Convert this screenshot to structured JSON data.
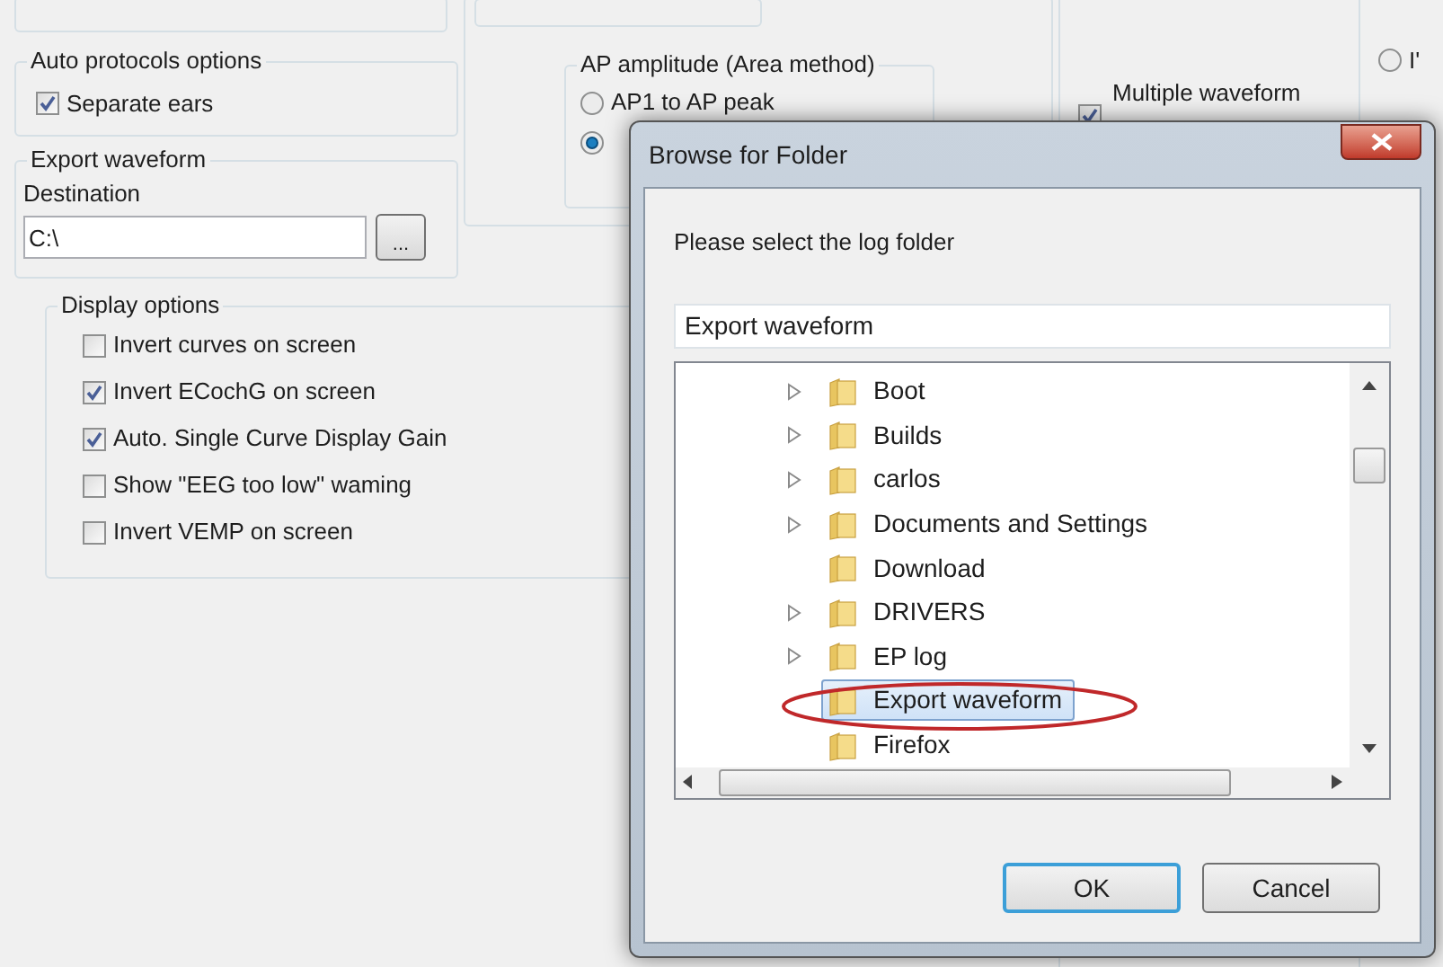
{
  "settings": {
    "auto_protocols": {
      "title": "Auto protocols options",
      "separate_ears": {
        "label": "Separate ears",
        "checked": true
      }
    },
    "export_waveform": {
      "title": "Export waveform",
      "destination_label": "Destination",
      "destination": "C:\\",
      "browse_button": "..."
    },
    "display_options": {
      "title": "Display options",
      "items": [
        {
          "label": "Invert curves on screen",
          "checked": false
        },
        {
          "label": "Invert ECochG on screen",
          "checked": true
        },
        {
          "label": "Auto. Single Curve Display Gain",
          "checked": true
        },
        {
          "label": "Show \"EEG too low\" waming",
          "checked": false
        },
        {
          "label": "Invert VEMP on screen",
          "checked": false
        }
      ]
    },
    "ap_amplitude": {
      "title": "AP amplitude (Area method)",
      "options": [
        {
          "label": "AP1 to AP peak",
          "selected": false
        },
        {
          "selected": true
        }
      ]
    },
    "multiple_waveform": {
      "label": "Multiple waveform",
      "checked": true
    },
    "column_3": {
      "options": [
        {
          "label": "I'",
          "selected": false
        }
      ]
    }
  },
  "dialog": {
    "title": "Browse for Folder",
    "prompt": "Please select the log folder",
    "folder_name": "Export waveform",
    "tree": [
      {
        "label": "Boot",
        "has_children": true,
        "selected": false
      },
      {
        "label": "Builds",
        "has_children": true,
        "selected": false
      },
      {
        "label": "carlos",
        "has_children": true,
        "selected": false
      },
      {
        "label": "Documents and Settings",
        "has_children": true,
        "selected": false
      },
      {
        "label": "Download",
        "has_children": false,
        "selected": false
      },
      {
        "label": "DRIVERS",
        "has_children": true,
        "selected": false
      },
      {
        "label": "EP log",
        "has_children": true,
        "selected": false
      },
      {
        "label": "Export waveform",
        "has_children": false,
        "selected": true
      },
      {
        "label": "Firefox",
        "has_children": false,
        "selected": false
      }
    ],
    "buttons": [
      {
        "label": "OK",
        "kind": "default"
      },
      {
        "label": "Cancel",
        "kind": "normal"
      }
    ]
  }
}
